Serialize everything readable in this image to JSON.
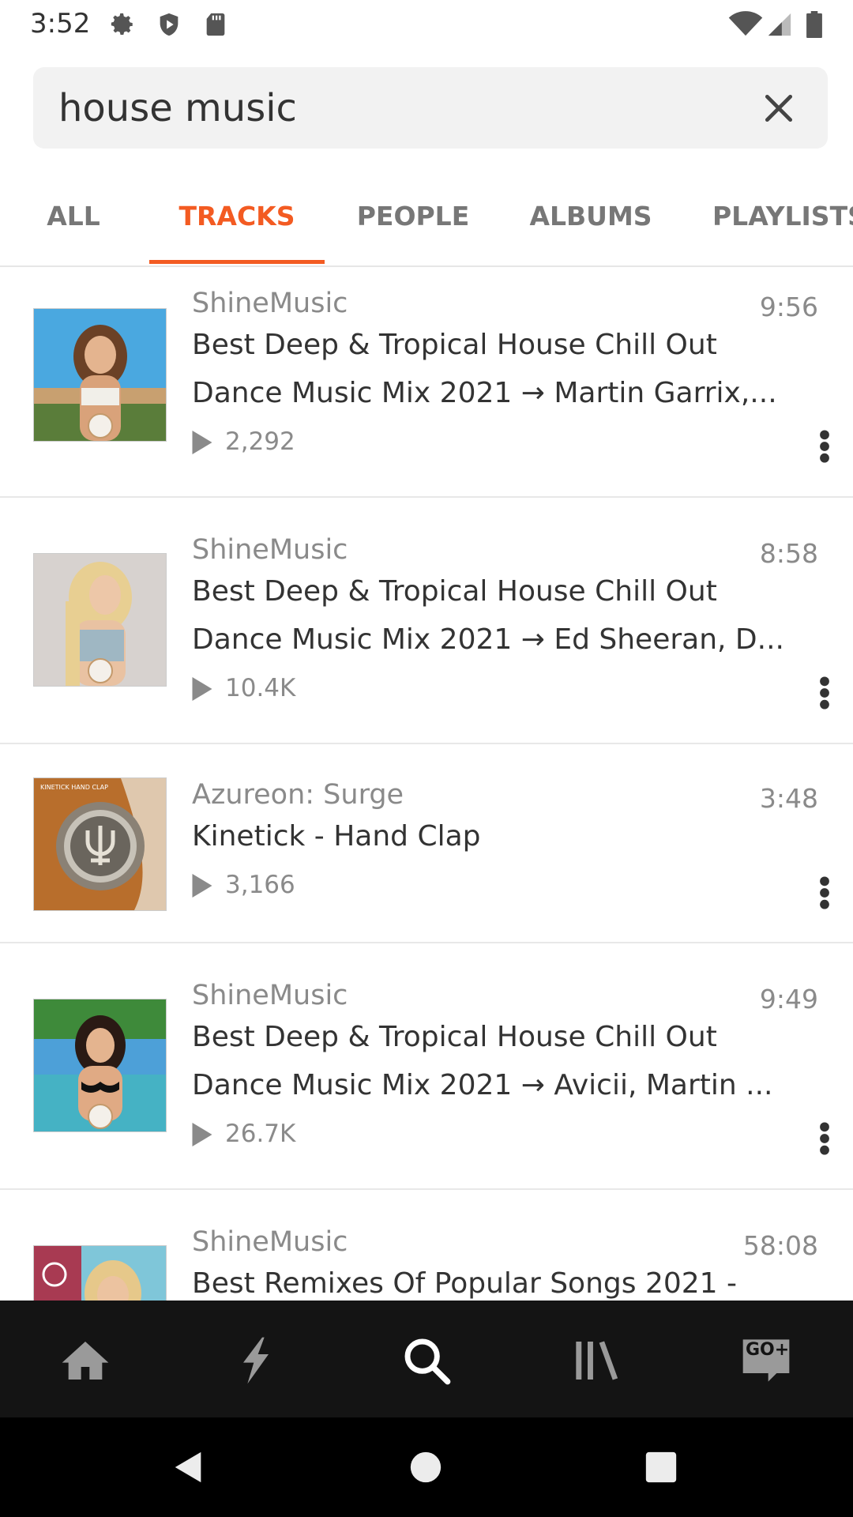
{
  "status_bar": {
    "time": "3:52",
    "left_icons": [
      "gear-icon",
      "shield-icon",
      "sd-card-icon"
    ],
    "right_icons": [
      "wifi-icon",
      "signal-icon",
      "battery-icon"
    ]
  },
  "search": {
    "value": "house music",
    "clear_icon": "close-icon"
  },
  "tabs": [
    {
      "label": "ALL",
      "active": false
    },
    {
      "label": "TRACKS",
      "active": true
    },
    {
      "label": "PEOPLE",
      "active": false
    },
    {
      "label": "ALBUMS",
      "active": false
    },
    {
      "label": "PLAYLISTS",
      "active": false
    }
  ],
  "tracks": [
    {
      "artist": "ShineMusic",
      "duration": "9:56",
      "title_line1": "Best Deep & Tropical House Chill Out",
      "title_line2": "Dance Music Mix 2021 → Martin Garrix,...",
      "plays": "2,292"
    },
    {
      "artist": "ShineMusic",
      "duration": "8:58",
      "title_line1": "Best Deep & Tropical House Chill Out",
      "title_line2": "Dance Music Mix 2021 → Ed Sheeran, D...",
      "plays": "10.4K"
    },
    {
      "artist": "Azureon: Surge",
      "duration": "3:48",
      "title_line1": "Kinetick - Hand Clap",
      "title_line2": "",
      "plays": "3,166",
      "art_text": "KINETICK HAND CLAP"
    },
    {
      "artist": "ShineMusic",
      "duration": "9:49",
      "title_line1": "Best Deep & Tropical House Chill Out",
      "title_line2": "Dance Music Mix 2021 → Avicii, Martin ...",
      "plays": "26.7K"
    },
    {
      "artist": "ShineMusic",
      "duration": "58:08",
      "title_line1": "Best Remixes Of Popular Songs 2021 -",
      "title_line2": "",
      "plays": ""
    }
  ],
  "bottom_nav": [
    {
      "icon": "home-icon",
      "active": false
    },
    {
      "icon": "lightning-icon",
      "active": false
    },
    {
      "icon": "search-icon",
      "active": true
    },
    {
      "icon": "library-icon",
      "active": false
    },
    {
      "icon": "go-plus-icon",
      "label": "GO+",
      "active": false
    }
  ],
  "system_nav": [
    "back-icon",
    "home-circle-icon",
    "recents-icon"
  ],
  "colors": {
    "accent": "#f35b22",
    "nav_background": "#141414",
    "search_background": "#f2f2f2"
  }
}
